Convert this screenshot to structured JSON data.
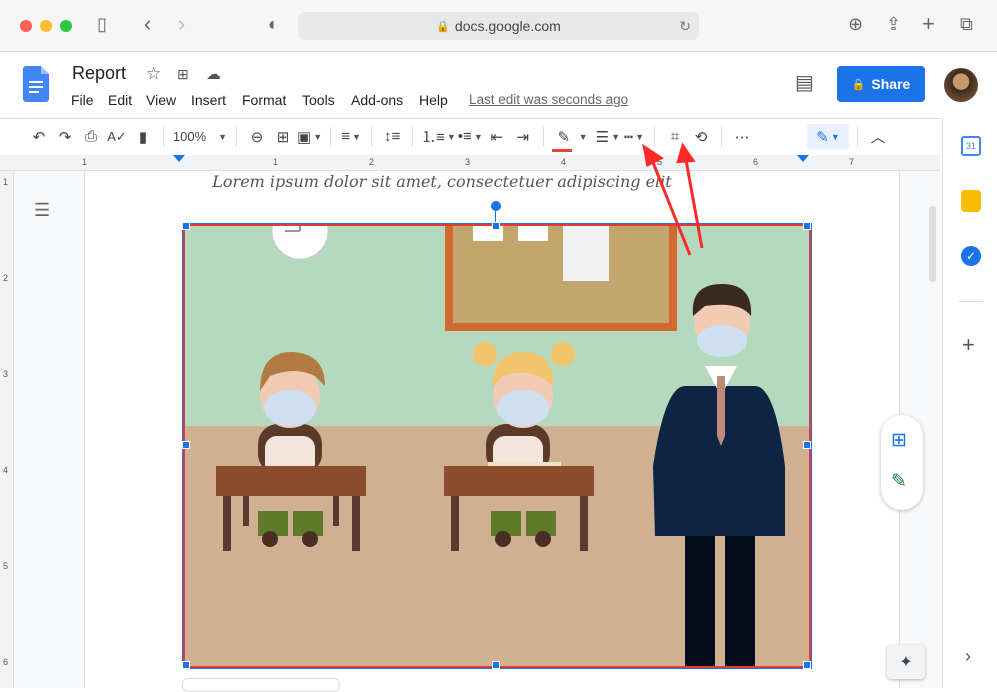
{
  "browser": {
    "url": "docs.google.com"
  },
  "doc": {
    "title": "Report",
    "menus": [
      "File",
      "Edit",
      "View",
      "Insert",
      "Format",
      "Tools",
      "Add-ons",
      "Help"
    ],
    "last_edit": "Last edit was seconds ago",
    "share_label": "Share"
  },
  "toolbar": {
    "zoom": "100%"
  },
  "ruler": {
    "h_labels": [
      "1",
      "1",
      "2",
      "3",
      "4",
      "5",
      "6",
      "7"
    ],
    "v_labels": [
      "1",
      "2",
      "3",
      "4",
      "5",
      "6"
    ]
  },
  "content": {
    "caption": "Lorem ipsum dolor sit amet, consectetuer adipiscing elit"
  },
  "colors": {
    "accent": "#1a73e8",
    "annotation": "#ff2a2a",
    "text_color_underline": "#ea4335"
  }
}
